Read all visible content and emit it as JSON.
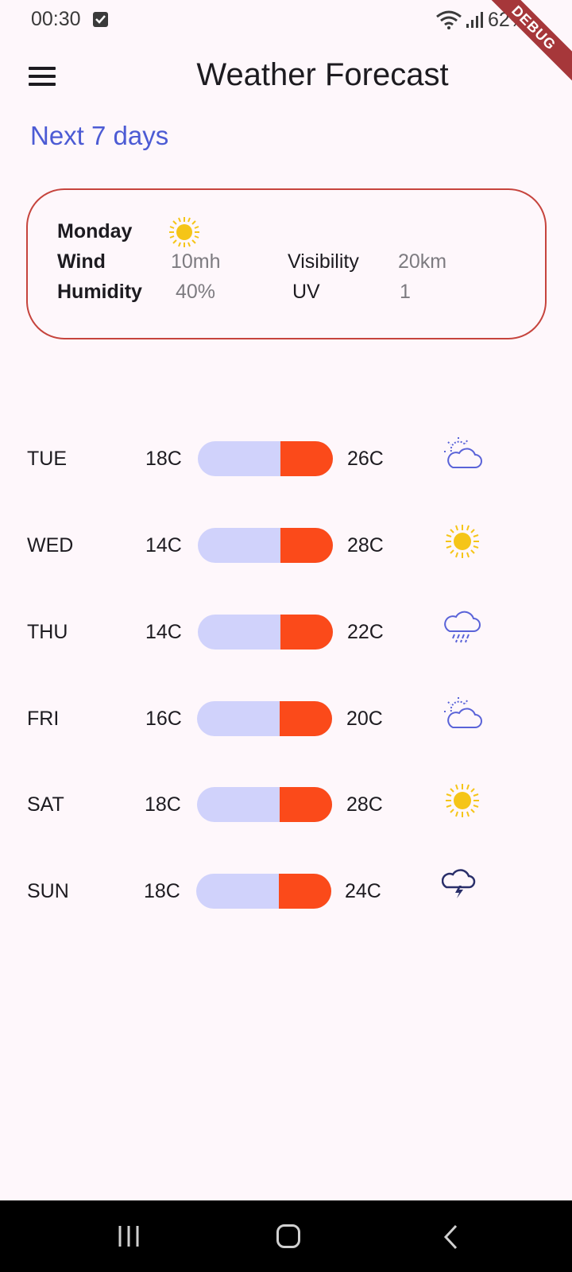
{
  "status_bar": {
    "time": "00:30",
    "battery": "62%",
    "debug": "DEBUG"
  },
  "app_bar": {
    "title": "Weather Forecast",
    "menu_icon": "menu-icon"
  },
  "subtitle": "Next 7 days",
  "today": {
    "day": "Monday",
    "icon": "sun-icon",
    "wind_label": "Wind",
    "wind_value": "10mh",
    "visibility_label": "Visibility",
    "visibility_value": "20km",
    "humidity_label": "Humidity",
    "humidity_value": "40%",
    "uv_label": "UV",
    "uv_value": "1"
  },
  "forecast": [
    {
      "day": "TUE",
      "low": "18C",
      "high": "26C",
      "icon": "partly-cloudy-icon",
      "fill_fraction": 0.39
    },
    {
      "day": "WED",
      "low": "14C",
      "high": "28C",
      "icon": "sun-icon",
      "fill_fraction": 0.39
    },
    {
      "day": "THU",
      "low": "14C",
      "high": "22C",
      "icon": "rain-cloud-icon",
      "fill_fraction": 0.39
    },
    {
      "day": "FRI",
      "low": "16C",
      "high": "20C",
      "icon": "partly-cloudy-icon",
      "fill_fraction": 0.39
    },
    {
      "day": "SAT",
      "low": "18C",
      "high": "28C",
      "icon": "sun-icon",
      "fill_fraction": 0.39
    },
    {
      "day": "SUN",
      "low": "18C",
      "high": "24C",
      "icon": "thunder-cloud-icon",
      "fill_fraction": 0.39
    }
  ],
  "colors": {
    "accent": "#4c5bd4",
    "card_border": "#c6443d",
    "bar_cold": "#d0d2fb",
    "bar_hot": "#fb4a1a",
    "sun": "#f5c518",
    "cloud": "#5a63d8"
  },
  "nav_bar": {
    "recent": "recent-apps-icon",
    "home": "home-icon",
    "back": "back-icon"
  }
}
